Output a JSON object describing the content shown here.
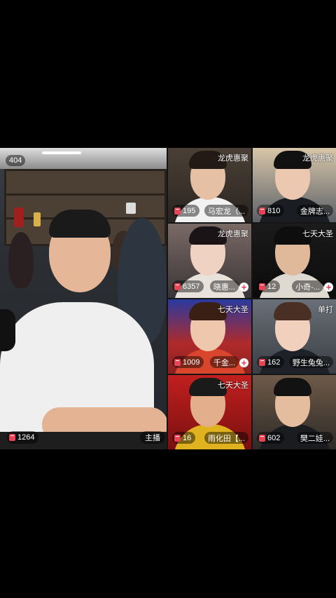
{
  "host": {
    "viewer_count": "404",
    "gift_count": "1264",
    "role_label": "主播"
  },
  "guests": [
    {
      "badge": "龙虎惠聚",
      "gift_count": "195",
      "name": "马宏龙（...",
      "follow": false
    },
    {
      "badge": "龙虎惠聚",
      "gift_count": "810",
      "name": "金牌志...",
      "follow": false
    },
    {
      "badge": "龙虎惠聚",
      "gift_count": "6357",
      "name": "晓惠...",
      "follow": true
    },
    {
      "badge": "七天大圣",
      "gift_count": "12",
      "name": "小奇-...",
      "follow": true
    },
    {
      "badge": "七天大圣",
      "gift_count": "1009",
      "name": "千金...",
      "follow": true
    },
    {
      "badge": "单打",
      "gift_count": "162",
      "name": "野生兔兔...",
      "follow": false
    },
    {
      "badge": "七天大圣",
      "gift_count": "16",
      "name": "雨化田【...",
      "follow": false
    },
    {
      "badge": "",
      "gift_count": "602",
      "name": "樊二娃...",
      "follow": false
    }
  ],
  "colors": {
    "background": "#000000",
    "accent_red": "#e84455",
    "follow_icon_color": "#e8334a"
  },
  "icons": {
    "gift": "gift-icon",
    "follow": "plus-circle-icon"
  }
}
